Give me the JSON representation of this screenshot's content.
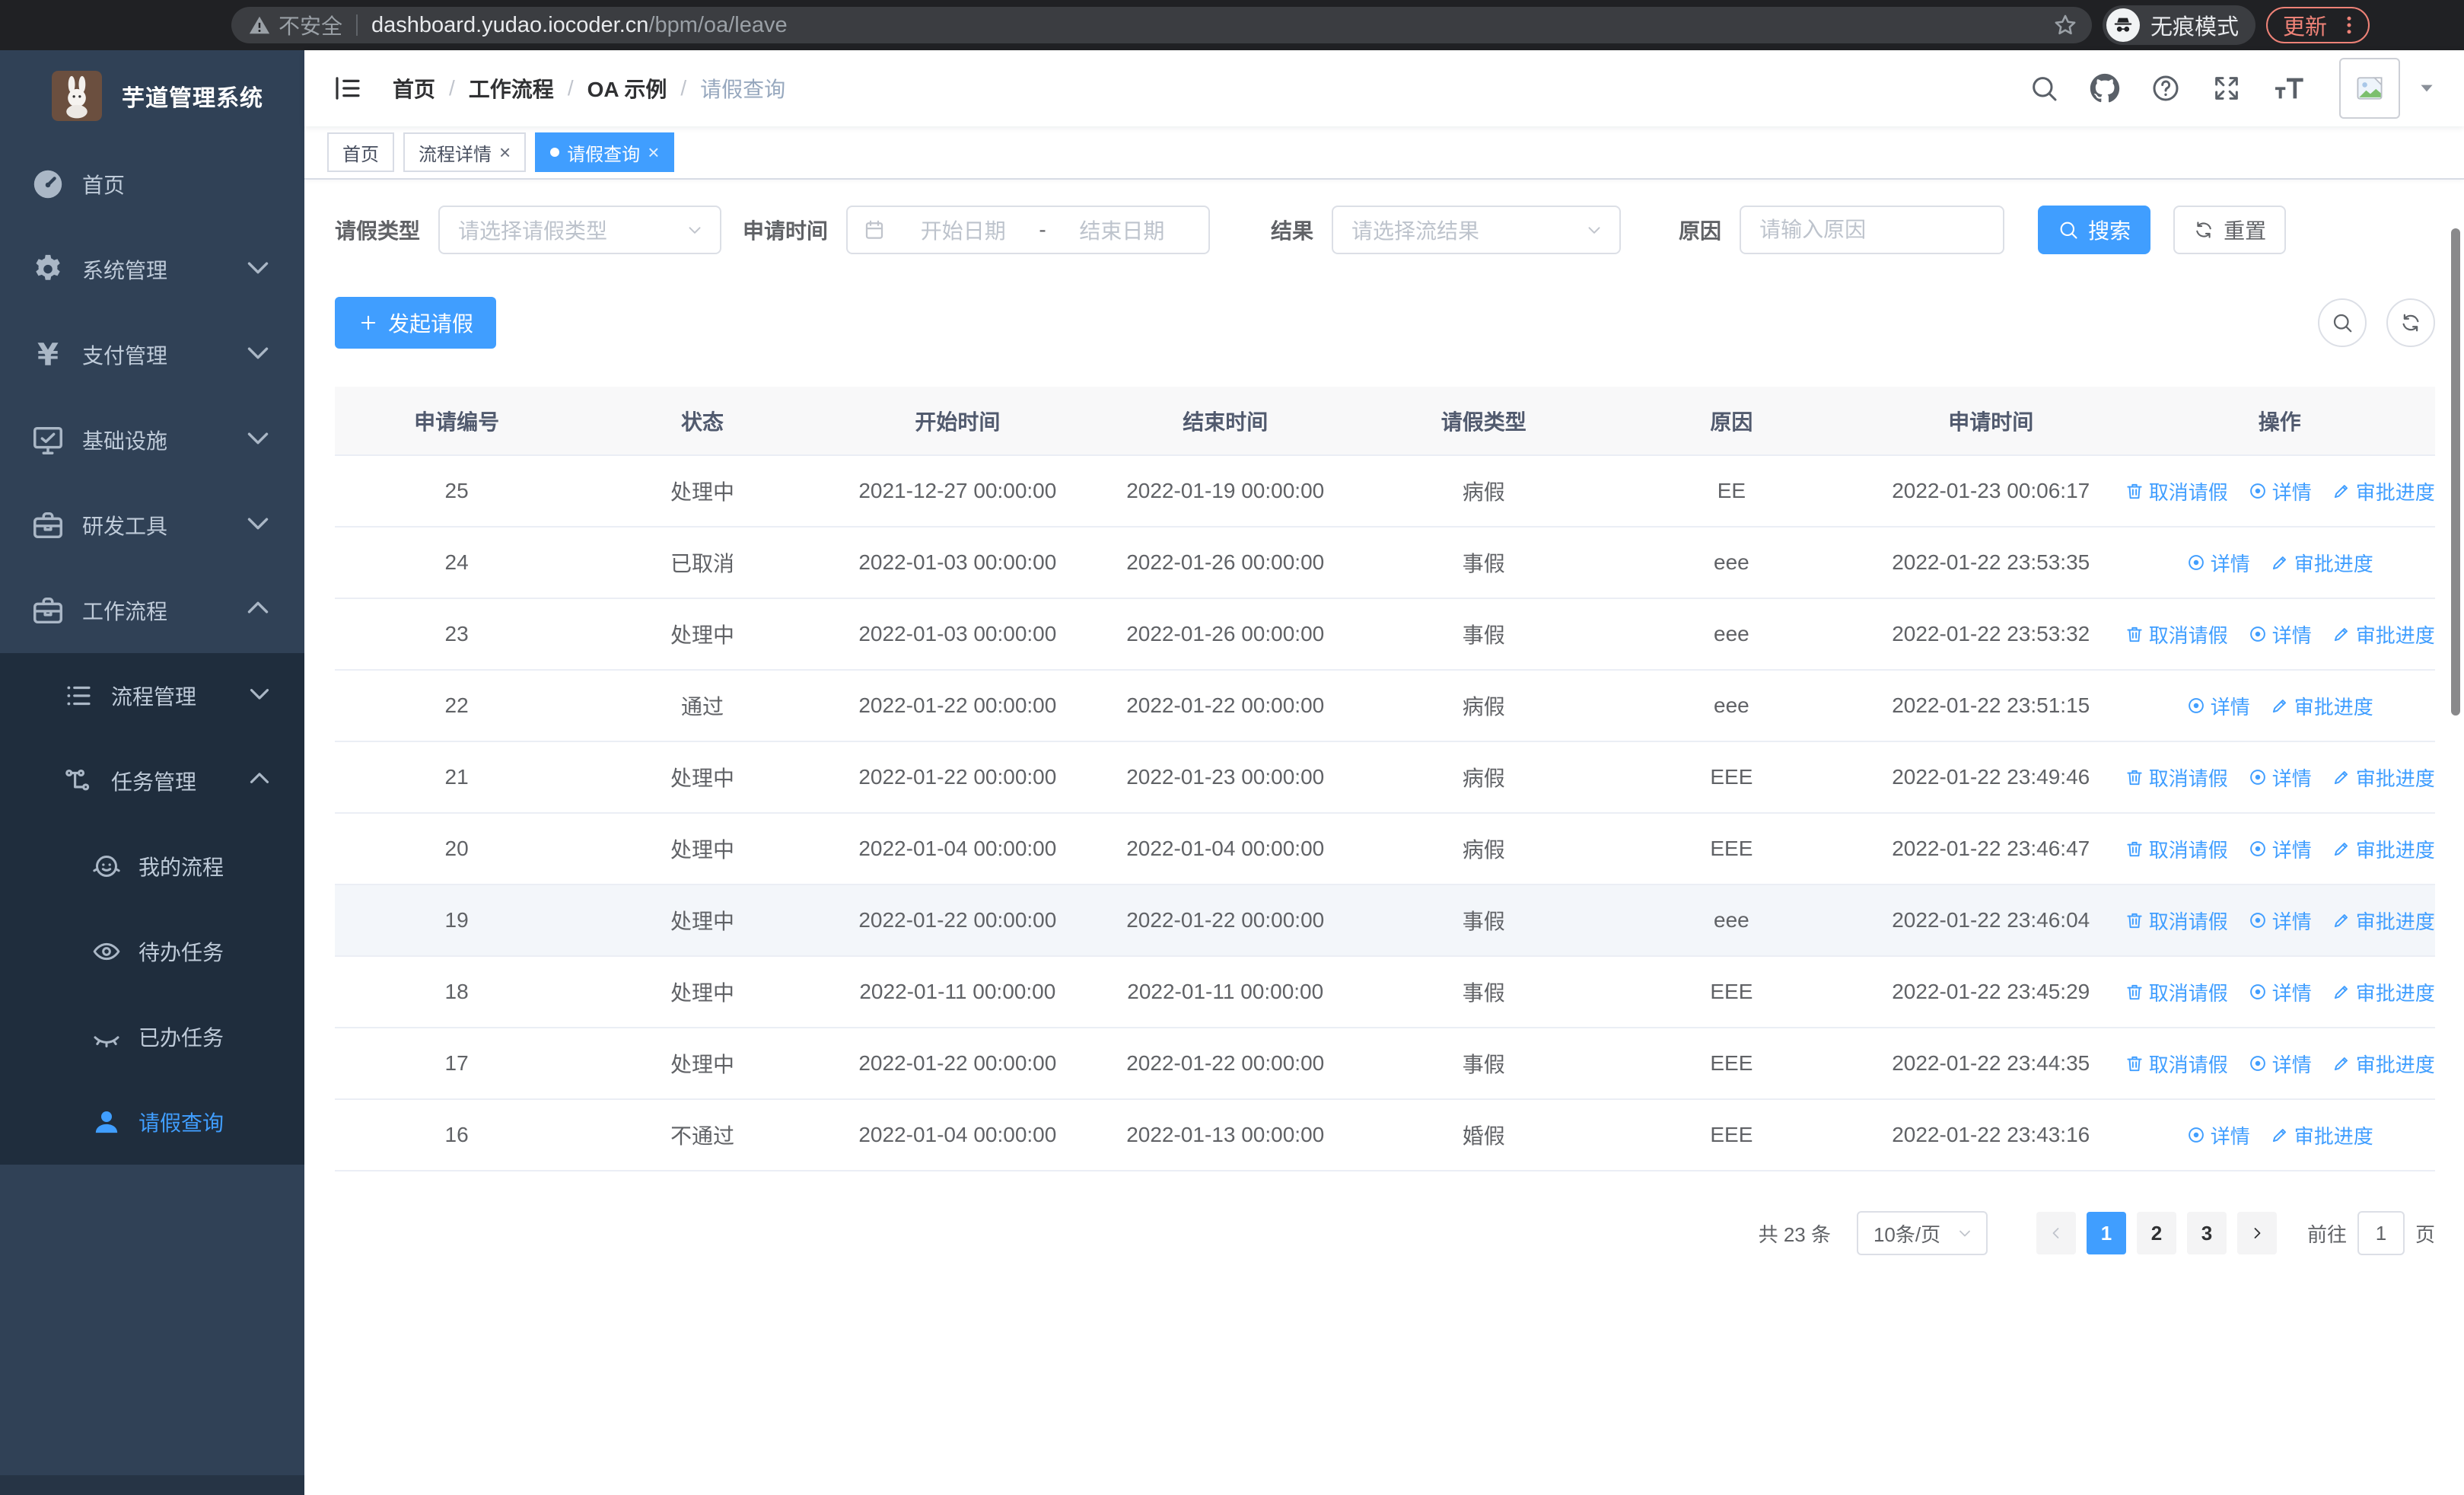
{
  "browser": {
    "security_label": "不安全",
    "url_domain": "dashboard.yudao.iocoder.cn",
    "url_path": "/bpm/oa/leave",
    "incognito_label": "无痕模式",
    "update_label": "更新"
  },
  "sidebar": {
    "title": "芋道管理系统",
    "items": [
      {
        "key": "home",
        "label": "首页",
        "icon": "gauge-icon",
        "level": 0
      },
      {
        "key": "system",
        "label": "系统管理",
        "icon": "gear-icon",
        "level": 0,
        "chevron": "down"
      },
      {
        "key": "payment",
        "label": "支付管理",
        "icon": "yen-icon",
        "level": 0,
        "chevron": "down"
      },
      {
        "key": "infrastructure",
        "label": "基础设施",
        "icon": "monitor-icon",
        "level": 0,
        "chevron": "down"
      },
      {
        "key": "dev-tools",
        "label": "研发工具",
        "icon": "toolbox-icon",
        "level": 0,
        "chevron": "down"
      },
      {
        "key": "workflow",
        "label": "工作流程",
        "icon": "briefcase-icon",
        "level": 0,
        "chevron": "up"
      },
      {
        "key": "process-mgmt",
        "label": "流程管理",
        "icon": "list-icon",
        "level": 1,
        "sub": true,
        "chevron": "down"
      },
      {
        "key": "task-mgmt",
        "label": "任务管理",
        "icon": "tree-icon",
        "level": 1,
        "sub": true,
        "chevron": "up"
      },
      {
        "key": "my-process",
        "label": "我的流程",
        "icon": "face-icon",
        "level": 2,
        "sub": true
      },
      {
        "key": "todo-tasks",
        "label": "待办任务",
        "icon": "eye-open-icon",
        "level": 2,
        "sub": true
      },
      {
        "key": "done-tasks",
        "label": "已办任务",
        "icon": "eye-closed-icon",
        "level": 2,
        "sub": true
      },
      {
        "key": "leave-query",
        "label": "请假查询",
        "icon": "user-icon",
        "level": 2,
        "sub": true,
        "active": true
      }
    ]
  },
  "header": {
    "breadcrumb": [
      "首页",
      "工作流程",
      "OA 示例",
      "请假查询"
    ]
  },
  "tabs": [
    {
      "key": "home",
      "label": "首页",
      "active": false,
      "closable": false
    },
    {
      "key": "process-detail",
      "label": "流程详情",
      "active": false,
      "closable": true
    },
    {
      "key": "leave-query",
      "label": "请假查询",
      "active": true,
      "closable": true
    }
  ],
  "filters": {
    "leave_type": {
      "label": "请假类型",
      "placeholder": "请选择请假类型"
    },
    "apply_time": {
      "label": "申请时间",
      "start_placeholder": "开始日期",
      "separator": "-",
      "end_placeholder": "结束日期"
    },
    "result": {
      "label": "结果",
      "placeholder": "请选择流结果"
    },
    "reason": {
      "label": "原因",
      "placeholder": "请输入原因"
    },
    "search_label": "搜索",
    "reset_label": "重置"
  },
  "toolbar": {
    "create_label": "发起请假"
  },
  "table": {
    "columns": [
      "申请编号",
      "状态",
      "开始时间",
      "结束时间",
      "请假类型",
      "原因",
      "申请时间",
      "操作"
    ],
    "action_labels": {
      "cancel": "取消请假",
      "detail": "详情",
      "progress": "审批进度"
    },
    "rows": [
      {
        "id": "25",
        "status": "处理中",
        "start": "2021-12-27 00:00:00",
        "end": "2022-01-19 00:00:00",
        "type": "病假",
        "reason": "EE",
        "apply_time": "2022-01-23 00:06:17",
        "actions": [
          "cancel",
          "detail",
          "progress"
        ]
      },
      {
        "id": "24",
        "status": "已取消",
        "start": "2022-01-03 00:00:00",
        "end": "2022-01-26 00:00:00",
        "type": "事假",
        "reason": "eee",
        "apply_time": "2022-01-22 23:53:35",
        "actions": [
          "detail",
          "progress"
        ]
      },
      {
        "id": "23",
        "status": "处理中",
        "start": "2022-01-03 00:00:00",
        "end": "2022-01-26 00:00:00",
        "type": "事假",
        "reason": "eee",
        "apply_time": "2022-01-22 23:53:32",
        "actions": [
          "cancel",
          "detail",
          "progress"
        ]
      },
      {
        "id": "22",
        "status": "通过",
        "start": "2022-01-22 00:00:00",
        "end": "2022-01-22 00:00:00",
        "type": "病假",
        "reason": "eee",
        "apply_time": "2022-01-22 23:51:15",
        "actions": [
          "detail",
          "progress"
        ]
      },
      {
        "id": "21",
        "status": "处理中",
        "start": "2022-01-22 00:00:00",
        "end": "2022-01-23 00:00:00",
        "type": "病假",
        "reason": "EEE",
        "apply_time": "2022-01-22 23:49:46",
        "actions": [
          "cancel",
          "detail",
          "progress"
        ]
      },
      {
        "id": "20",
        "status": "处理中",
        "start": "2022-01-04 00:00:00",
        "end": "2022-01-04 00:00:00",
        "type": "病假",
        "reason": "EEE",
        "apply_time": "2022-01-22 23:46:47",
        "actions": [
          "cancel",
          "detail",
          "progress"
        ]
      },
      {
        "id": "19",
        "status": "处理中",
        "start": "2022-01-22 00:00:00",
        "end": "2022-01-22 00:00:00",
        "type": "事假",
        "reason": "eee",
        "apply_time": "2022-01-22 23:46:04",
        "actions": [
          "cancel",
          "detail",
          "progress"
        ],
        "highlighted": true
      },
      {
        "id": "18",
        "status": "处理中",
        "start": "2022-01-11 00:00:00",
        "end": "2022-01-11 00:00:00",
        "type": "事假",
        "reason": "EEE",
        "apply_time": "2022-01-22 23:45:29",
        "actions": [
          "cancel",
          "detail",
          "progress"
        ]
      },
      {
        "id": "17",
        "status": "处理中",
        "start": "2022-01-22 00:00:00",
        "end": "2022-01-22 00:00:00",
        "type": "事假",
        "reason": "EEE",
        "apply_time": "2022-01-22 23:44:35",
        "actions": [
          "cancel",
          "detail",
          "progress"
        ]
      },
      {
        "id": "16",
        "status": "不通过",
        "start": "2022-01-04 00:00:00",
        "end": "2022-01-13 00:00:00",
        "type": "婚假",
        "reason": "EEE",
        "apply_time": "2022-01-22 23:43:16",
        "actions": [
          "detail",
          "progress"
        ]
      }
    ]
  },
  "pagination": {
    "total_label": "共 23 条",
    "page_size": "10条/页",
    "pages": [
      "1",
      "2",
      "3"
    ],
    "active_page": "1",
    "goto_label": "前往",
    "goto_value": "1",
    "page_suffix": "页"
  },
  "colors": {
    "primary": "#409eff",
    "sidebar_bg": "#304156",
    "submenu_bg": "#1f2d3d",
    "sidebar_text": "#bfcbd9",
    "breadcrumb_muted": "#97a8be",
    "table_border": "#ebeef5",
    "update_chip": "#ee8277"
  }
}
